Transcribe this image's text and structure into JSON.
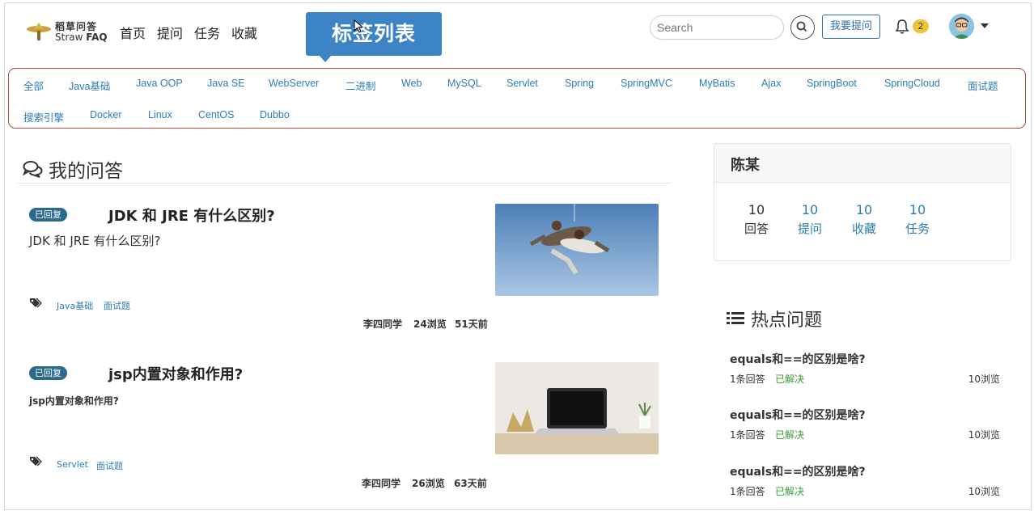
{
  "header": {
    "logo_cn": "稻草问答",
    "logo_en_a": "Straw",
    "logo_en_b": "FAQ",
    "nav": [
      "首页",
      "提问",
      "任务",
      "收藏"
    ],
    "callout": "标签列表",
    "search_placeholder": "Search",
    "ask_button": "我要提问",
    "notification_count": "2"
  },
  "tags_row1": [
    "全部",
    "Java基础",
    "Java OOP",
    "Java SE",
    "WebServer",
    "二进制",
    "Web",
    "MySQL",
    "Servlet",
    "Spring",
    "SpringMVC",
    "MyBatis",
    "Ajax",
    "SpringBoot",
    "SpringCloud",
    "面试题"
  ],
  "tags_row2": [
    "搜索引擎",
    "Docker",
    "Linux",
    "CentOS",
    "Dubbo"
  ],
  "main": {
    "section_title": "我的问答",
    "questions": [
      {
        "status": "已回复",
        "title": "JDK 和 JRE 有什么区别?",
        "desc": "JDK 和 JRE 有什么区别?",
        "tags": [
          "Java基础",
          "面试题"
        ],
        "author": "李四同学",
        "views": "24浏览",
        "time": "51天前",
        "image": "skydivers-photo"
      },
      {
        "status": "已回复",
        "title": "jsp内置对象和作用?",
        "desc": "jsp内置对象和作用?",
        "tags": [
          "Servlet",
          "面试题"
        ],
        "author": "李四同学",
        "views": "26浏览",
        "time": "63天前",
        "image": "laptop-desk-photo"
      }
    ]
  },
  "sidebar": {
    "user_name": "陈某",
    "stats": [
      {
        "num": "10",
        "label": "回答"
      },
      {
        "num": "10",
        "label": "提问"
      },
      {
        "num": "10",
        "label": "收藏"
      },
      {
        "num": "10",
        "label": "任务"
      }
    ],
    "hot_title": "热点问题",
    "hot": [
      {
        "title": "equals和==的区别是啥?",
        "answers": "1条回答",
        "state": "已解决",
        "views": "10浏览"
      },
      {
        "title": "equals和==的区别是啥?",
        "answers": "1条回答",
        "state": "已解决",
        "views": "10浏览"
      },
      {
        "title": "equals和==的区别是啥?",
        "answers": "1条回答",
        "state": "已解决",
        "views": "10浏览"
      }
    ]
  },
  "colors": {
    "accent": "#3d84c6",
    "link": "#2c7db0",
    "badge": "#f0c33a",
    "tag_border": "#b0483e",
    "status": "#2b6a8a",
    "solved": "#3a9a3a"
  }
}
